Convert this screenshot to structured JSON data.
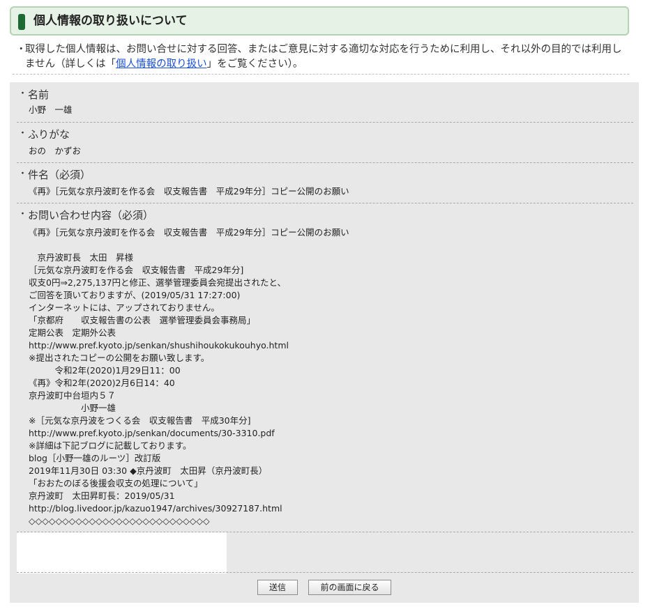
{
  "header": {
    "title": "個人情報の取り扱いについて"
  },
  "intro": {
    "bullet": "・",
    "text_before": "取得した個人情報は、お問い合せに対する回答、またはご意見に対する適切な対応を行うために利用し、それ以外の目的では利用しません（詳しくは「",
    "link_text": "個人情報の取り扱い",
    "text_after": "」をご覧ください）。"
  },
  "fields": {
    "name": {
      "label": "名前",
      "value": "小野　一雄"
    },
    "furigana": {
      "label": "ふりがな",
      "value": "おの　かずお"
    },
    "subject": {
      "label": "件名（必須）",
      "value": "《再》［元気な京丹波町を作る会　収支報告書　平成29年分］コピー公開のお願い"
    },
    "inquiry": {
      "label": "お問い合わせ内容（必須）",
      "lines": [
        "《再》［元気な京丹波町を作る会　収支報告書　平成29年分］コピー公開のお願い",
        "",
        "　京丹波町長　太田　昇様",
        "［元気な京丹波町を作る会　収支報告書　平成29年分]",
        "収支0円⇒2,275,137円と修正、選挙管理委員会宛提出されたと、",
        "ご回答を頂いておりますが、(2019/05/31 17:27:00)",
        "インターネットには、アップされておりません。",
        "「京都府　　収支報告書の公表　選挙管理委員会事務局」",
        "定期公表　定期外公表",
        "http://www.pref.kyoto.jp/senkan/shushihoukokukouhyo.html",
        "※提出されたコピーの公開をお願い致します。",
        "　　　令和2年(2020)1月29日11：00",
        "《再》令和2年(2020)2月6日14：40",
        "京丹波町中台垣内５７",
        "　　　　　　小野一雄",
        "※［元気な京丹波をつくる会　収支報告書　平成30年分]",
        "http://www.pref.kyoto.jp/senkan/documents/30-3310.pdf",
        "※詳細は下記ブログに記載しております。",
        "blog［小野一雄のルーツ］改訂版",
        "2019年11月30日 03:30 ◆京丹波町　太田昇（京丹波町長）",
        "「おおたのぼる後援会収支の処理について」",
        "京丹波町　太田昇町長：2019/05/31",
        "http://blog.livedoor.jp/kazuo1947/archives/30927187.html",
        "◇◇◇◇◇◇◇◇◇◇◇◇◇◇◇◇◇◇◇◇◇◇◇◇◇◇◇"
      ]
    }
  },
  "buttons": {
    "submit": "送信",
    "back": "前の画面に戻る"
  },
  "colors": {
    "header_bg": "#e6f2e6",
    "header_border": "#b4d2b4",
    "header_bar": "#1e6a34",
    "form_bg": "#e8e8e8",
    "link": "#1a4ed8"
  }
}
